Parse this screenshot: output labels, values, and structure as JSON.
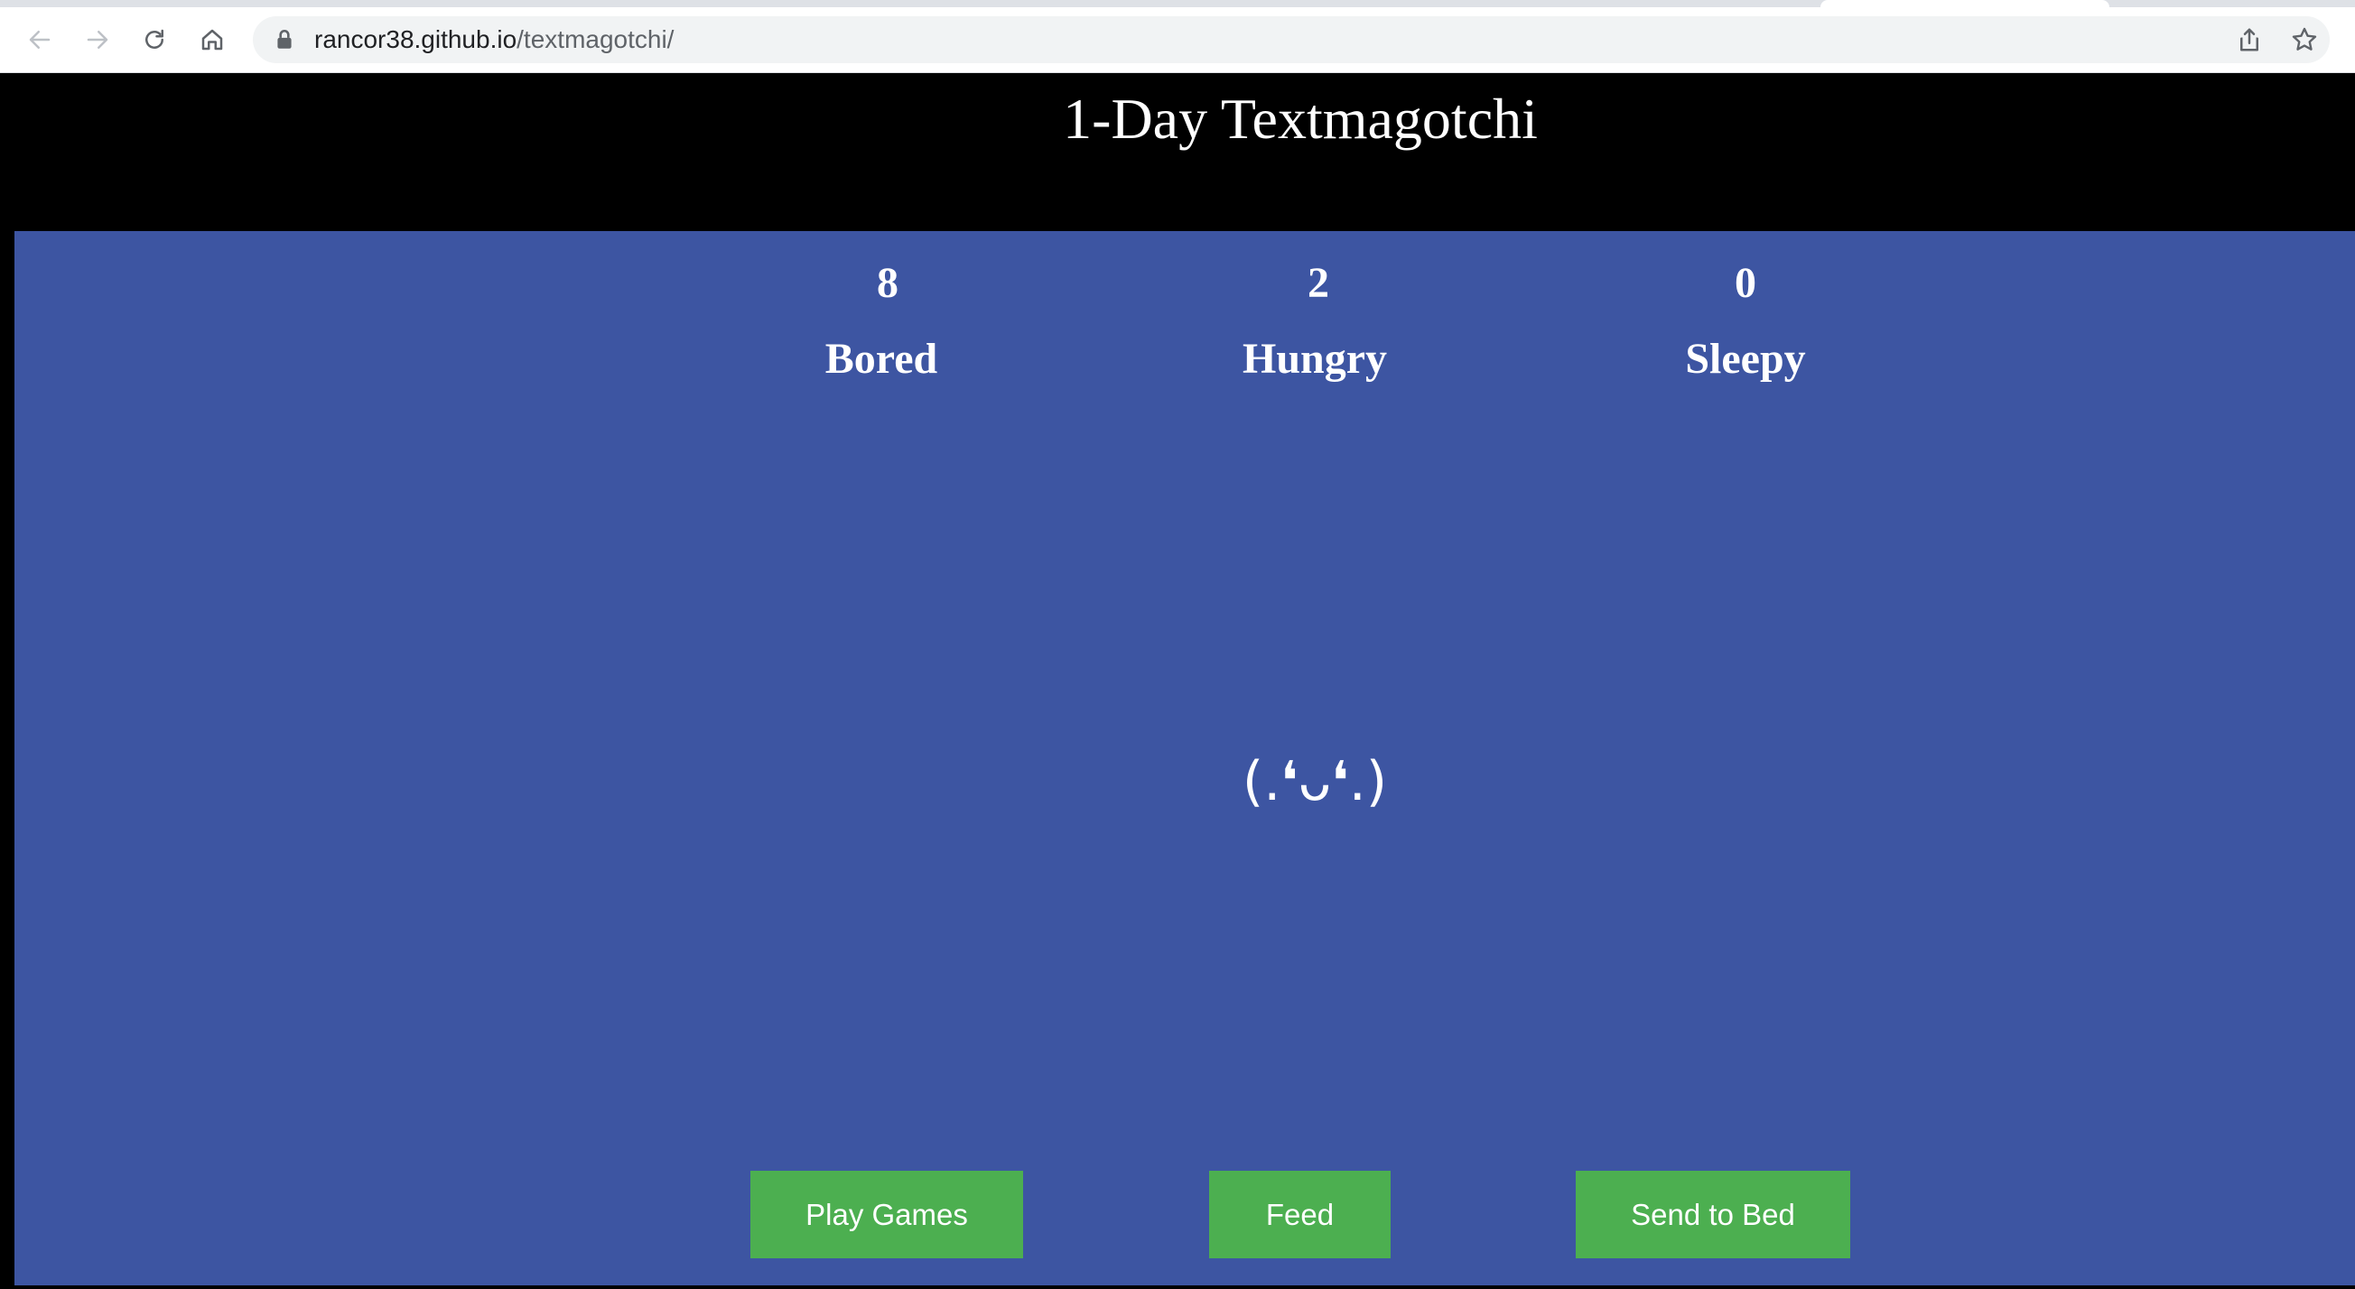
{
  "browser": {
    "url_domain": "rancor38.github.io",
    "url_path": "/textmagotchi/",
    "icons": [
      "back-icon",
      "forward-icon",
      "reload-icon",
      "home-icon",
      "lock-icon",
      "share-icon",
      "bookmark-star-icon"
    ]
  },
  "page": {
    "title": "1-Day Textmagotchi",
    "colors": {
      "header_bg": "#000000",
      "main_bg": "#3d55a2",
      "button_bg": "#4caf50",
      "text": "#ffffff"
    }
  },
  "stats": {
    "bored": {
      "value": "8",
      "label": "Bored"
    },
    "hungry": {
      "value": "2",
      "label": "Hungry"
    },
    "sleepy": {
      "value": "0",
      "label": "Sleepy"
    }
  },
  "pet": {
    "face": "(.❛ᴗ❛.)"
  },
  "actions": {
    "play_label": "Play Games",
    "feed_label": "Feed",
    "bed_label": "Send to Bed"
  }
}
